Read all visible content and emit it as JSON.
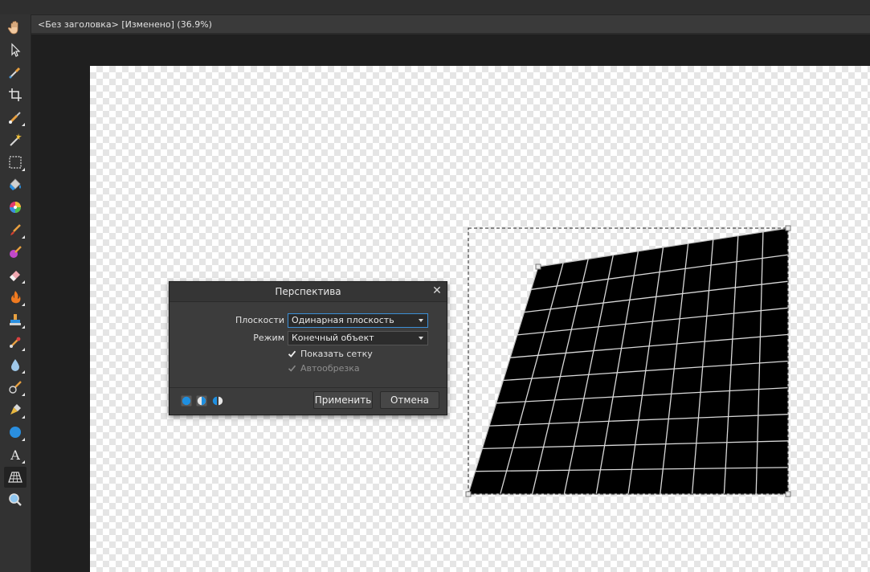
{
  "document": {
    "title": "<Без заголовка> [Изменено] (36.9%)"
  },
  "toolbar": {
    "tools": [
      {
        "name": "hand-tool",
        "icon": "hand-icon"
      },
      {
        "name": "move-tool",
        "icon": "pointer-arrow-icon"
      },
      {
        "name": "color-picker-tool",
        "icon": "eyedropper-icon"
      },
      {
        "name": "crop-tool",
        "icon": "crop-icon"
      },
      {
        "name": "selection-brush-tool",
        "icon": "selection-brush-icon"
      },
      {
        "name": "flood-select-tool",
        "icon": "magic-wand-icon"
      },
      {
        "name": "marquee-tool",
        "icon": "rectangle-marquee-icon"
      },
      {
        "name": "flood-fill-tool",
        "icon": "paint-bucket-icon"
      },
      {
        "name": "gradient-tool",
        "icon": "color-wheel-icon"
      },
      {
        "name": "paint-brush-tool",
        "icon": "paint-brush-icon"
      },
      {
        "name": "color-replace-tool",
        "icon": "color-replace-brush-icon"
      },
      {
        "name": "erase-brush-tool",
        "icon": "eraser-icon"
      },
      {
        "name": "dodge-tool",
        "icon": "flame-icon"
      },
      {
        "name": "clone-tool",
        "icon": "clone-stamp-icon"
      },
      {
        "name": "inpainting-tool",
        "icon": "healing-brush-icon"
      },
      {
        "name": "blur-tool",
        "icon": "water-drop-icon"
      },
      {
        "name": "smudge-tool",
        "icon": "smudge-icon"
      },
      {
        "name": "pen-tool",
        "icon": "pen-nib-icon"
      },
      {
        "name": "shape-tool",
        "icon": "ellipse-shape-icon"
      },
      {
        "name": "text-tool",
        "icon": "text-icon"
      },
      {
        "name": "perspective-tool",
        "icon": "perspective-grid-icon"
      },
      {
        "name": "zoom-tool",
        "icon": "magnifier-icon"
      }
    ],
    "active_tool": "perspective-tool"
  },
  "dialog": {
    "title": "Перспектива",
    "planes_label": "Плоскости",
    "planes_value": "Одинарная плоскость",
    "mode_label": "Режим",
    "mode_value": "Конечный объект",
    "show_grid_label": "Показать сетку",
    "show_grid_checked": true,
    "autocrop_label": "Автообрезка",
    "autocrop_checked": true,
    "autocrop_enabled": false,
    "apply_label": "Применить",
    "cancel_label": "Отмена",
    "mode_icons": [
      "full-circle-icon",
      "half-circle-icon",
      "split-circle-icon"
    ],
    "close_icon": "close-icon"
  },
  "colors": {
    "accent": "#1e8fe0",
    "selection_border": "#3c8fd6",
    "grid_lines": "#d8d8d8",
    "quad_fill": "#000000"
  }
}
